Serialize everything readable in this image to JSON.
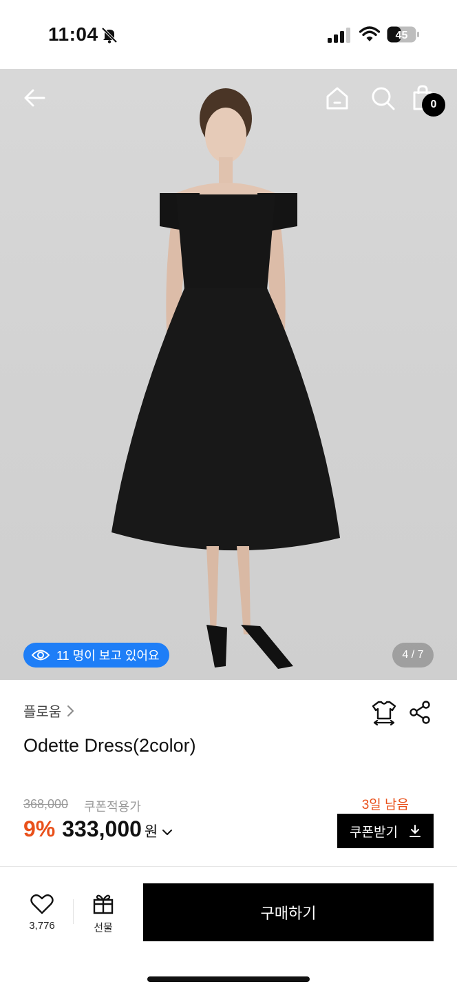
{
  "status_bar": {
    "time": "11:04",
    "battery": "45"
  },
  "header": {
    "cart_count": "0"
  },
  "image": {
    "viewers_text": "11 명이 보고 있어요",
    "page_indicator": "4 / 7",
    "colors": {
      "pill": "#1e7ef7",
      "background": "#d4d4d4"
    }
  },
  "product": {
    "brand": "플로움",
    "name": "Odette Dress(2color)",
    "original_price": "368,000",
    "price_note": "쿠폰적용가",
    "days_left": "3일 남음",
    "discount": "9%",
    "price": "333,000",
    "currency": "원",
    "coupon_button": "쿠폰받기",
    "accent_color": "#e9501a"
  },
  "bottom_bar": {
    "like_count": "3,776",
    "gift_label": "선물",
    "buy_button": "구매하기"
  },
  "icons": [
    "back-arrow-icon",
    "home-icon",
    "search-icon",
    "shopping-bag-icon",
    "eye-icon",
    "chevron-right-icon",
    "size-guide-icon",
    "share-icon",
    "chevron-down-icon",
    "download-icon",
    "heart-icon",
    "gift-icon"
  ]
}
